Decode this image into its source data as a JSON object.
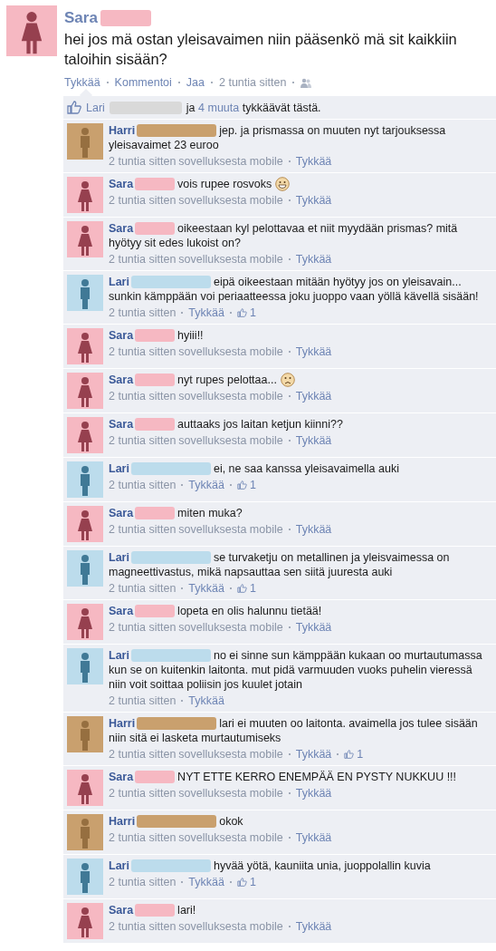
{
  "post": {
    "author": "Sara",
    "avatar": {
      "kind": "female",
      "color": "#f6b8c2"
    },
    "text": "hei jos mä ostan yleisavaimen niin pääsenkö mä sit kaikkiin taloihin sisään?",
    "actions": [
      "Tykkää",
      "Kommentoi",
      "Jaa"
    ],
    "time": "2 tuntia sitten"
  },
  "likes_summary": {
    "name": "Lari",
    "and": "ja",
    "others": "4 muuta",
    "rest": "tykkäävät tästä."
  },
  "comments": [
    {
      "author": "Harri",
      "avatar": {
        "kind": "male",
        "color": "#c9a06e"
      },
      "text": "jep. ja prismassa on muuten nyt tarjouksessa yleisavaimet 23 euroo",
      "time": "2 tuntia sitten",
      "source": "sovelluksesta mobile",
      "like": "Tykkää"
    },
    {
      "author": "Sara",
      "avatar": {
        "kind": "female",
        "color": "#f6b8c2"
      },
      "text": "vois rupee rosvoks",
      "emoticon": {
        "kind": "grin"
      },
      "time": "2 tuntia sitten",
      "source": "sovelluksesta mobile",
      "like": "Tykkää"
    },
    {
      "author": "Sara",
      "avatar": {
        "kind": "female",
        "color": "#f6b8c2"
      },
      "text": "oikeestaan kyl pelottavaa et niit myydään prismas? mitä hyötyy sit edes lukoist on?",
      "time": "2 tuntia sitten",
      "source": "sovelluksesta mobile",
      "like": "Tykkää"
    },
    {
      "author": "Lari",
      "avatar": {
        "kind": "male",
        "color": "#bcdcec"
      },
      "text": "eipä oikeestaan mitään hyötyy jos on yleisavain... sunkin kämppään voi periaatteessa joku juoppo vaan yöllä kävellä sisään!",
      "time": "2 tuntia sitten",
      "like": "Tykkää",
      "likes": "1"
    },
    {
      "author": "Sara",
      "avatar": {
        "kind": "female",
        "color": "#f6b8c2"
      },
      "text": "hyiii!!",
      "time": "2 tuntia sitten",
      "source": "sovelluksesta mobile",
      "like": "Tykkää"
    },
    {
      "author": "Sara",
      "avatar": {
        "kind": "female",
        "color": "#f6b8c2"
      },
      "text": "nyt rupes pelottaa...",
      "emoticon": {
        "kind": "frown"
      },
      "time": "2 tuntia sitten",
      "source": "sovelluksesta mobile",
      "like": "Tykkää"
    },
    {
      "author": "Sara",
      "avatar": {
        "kind": "female",
        "color": "#f6b8c2"
      },
      "text": "auttaaks jos laitan ketjun kiinni??",
      "time": "2 tuntia sitten",
      "source": "sovelluksesta mobile",
      "like": "Tykkää"
    },
    {
      "author": "Lari",
      "avatar": {
        "kind": "male",
        "color": "#bcdcec"
      },
      "text": "ei, ne saa kanssa yleisavaimella auki",
      "time": "2 tuntia sitten",
      "like": "Tykkää",
      "likes": "1"
    },
    {
      "author": "Sara",
      "avatar": {
        "kind": "female",
        "color": "#f6b8c2"
      },
      "text": "miten muka?",
      "time": "2 tuntia sitten",
      "source": "sovelluksesta mobile",
      "like": "Tykkää"
    },
    {
      "author": "Lari",
      "avatar": {
        "kind": "male",
        "color": "#bcdcec"
      },
      "text": "se turvaketju on metallinen ja yleisvaimessa on magneettivastus, mikä napsauttaa sen siitä juuresta auki",
      "time": "2 tuntia sitten",
      "like": "Tykkää",
      "likes": "1"
    },
    {
      "author": "Sara",
      "avatar": {
        "kind": "female",
        "color": "#f6b8c2"
      },
      "text": "lopeta en olis halunnu tietää!",
      "time": "2 tuntia sitten",
      "source": "sovelluksesta mobile",
      "like": "Tykkää"
    },
    {
      "author": "Lari",
      "avatar": {
        "kind": "male",
        "color": "#bcdcec"
      },
      "text": "no ei sinne sun kämppään kukaan oo murtautumassa kun se on kuitenkin laitonta. mut pidä varmuuden vuoks puhelin vieressä niin voit soittaa poliisin jos kuulet jotain",
      "time": "2 tuntia sitten",
      "like": "Tykkää"
    },
    {
      "author": "Harri",
      "avatar": {
        "kind": "male",
        "color": "#c9a06e"
      },
      "text": "lari ei muuten oo laitonta. avaimella jos tulee sisään niin sitä ei lasketa murtautumiseks",
      "time": "2 tuntia sitten",
      "source": "sovelluksesta mobile",
      "like": "Tykkää",
      "likes": "1"
    },
    {
      "author": "Sara",
      "avatar": {
        "kind": "female",
        "color": "#f6b8c2"
      },
      "text": "NYT ETTE KERRO ENEMPÄÄ EN PYSTY NUKKUU !!!",
      "time": "2 tuntia sitten",
      "source": "sovelluksesta mobile",
      "like": "Tykkää"
    },
    {
      "author": "Harri",
      "avatar": {
        "kind": "male",
        "color": "#c9a06e"
      },
      "text": "okok",
      "time": "2 tuntia sitten",
      "source": "sovelluksesta mobile",
      "like": "Tykkää"
    },
    {
      "author": "Lari",
      "avatar": {
        "kind": "male",
        "color": "#bcdcec"
      },
      "text": "hyvää yötä, kauniita unia, juoppolallin kuvia",
      "time": "2 tuntia sitten",
      "like": "Tykkää",
      "likes": "1"
    },
    {
      "author": "Sara",
      "avatar": {
        "kind": "female",
        "color": "#f6b8c2"
      },
      "text": "lari!",
      "time": "2 tuntia sitten",
      "source": "sovelluksesta mobile",
      "like": "Tykkää"
    }
  ]
}
